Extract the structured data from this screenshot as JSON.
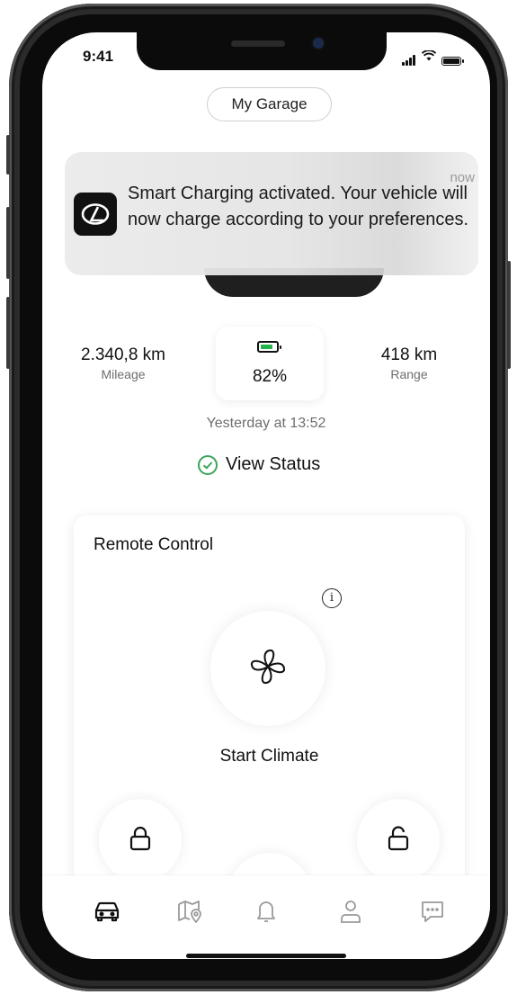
{
  "status_bar": {
    "time": "9:41"
  },
  "header": {
    "garage_button_label": "My Garage"
  },
  "notification": {
    "message": "Smart Charging activated. Your vehicle will now charge according to your preferences.",
    "time": "now",
    "app_icon": "lexus-logo-icon"
  },
  "stats": {
    "mileage_value": "2.340,8 km",
    "mileage_label": "Mileage",
    "battery_percent": "82%",
    "battery_level": 0.82,
    "battery_color": "#25b34b",
    "range_value": "418 km",
    "range_label": "Range"
  },
  "last_updated": "Yesterday at 13:52",
  "view_status": {
    "label": "View Status",
    "icon": "check-circle-icon",
    "color": "#3aa55a"
  },
  "remote_control": {
    "title": "Remote Control",
    "info_icon": "info-icon",
    "climate_label": "Start Climate",
    "climate_icon": "fan-icon",
    "lock_icon": "lock-icon",
    "unlock_icon": "unlock-icon"
  },
  "tab_bar": {
    "tabs": [
      {
        "icon": "car-icon",
        "active": true
      },
      {
        "icon": "map-pin-icon",
        "active": false
      },
      {
        "icon": "bell-icon",
        "active": false
      },
      {
        "icon": "user-icon",
        "active": false
      },
      {
        "icon": "chat-icon",
        "active": false
      }
    ]
  }
}
